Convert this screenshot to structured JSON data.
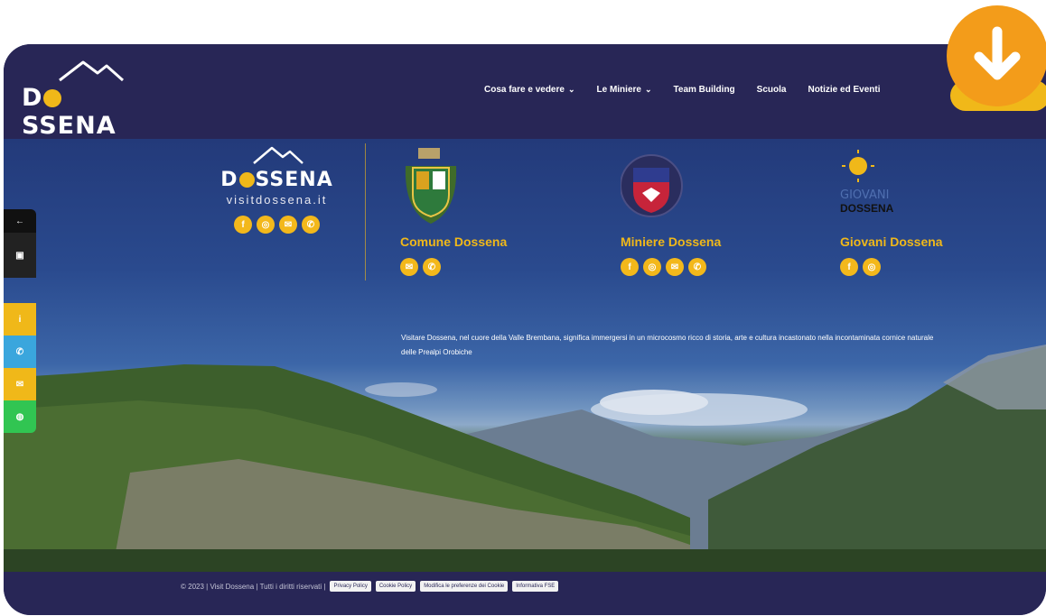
{
  "header": {
    "logo_text_pre": "D",
    "logo_text_post": "SSENA",
    "nav": [
      {
        "label": "Cosa fare e vedere",
        "has_dropdown": true
      },
      {
        "label": "Le Miniere",
        "has_dropdown": true
      },
      {
        "label": "Team Building",
        "has_dropdown": false
      },
      {
        "label": "Scuola",
        "has_dropdown": false
      },
      {
        "label": "Notizie ed Eventi",
        "has_dropdown": false
      }
    ],
    "dropdown_icon": "chevron-down-icon"
  },
  "brand": {
    "name_pre": "D",
    "name_post": "SSENA",
    "site": "visitdossena.it",
    "socials": [
      "facebook-icon",
      "instagram-icon",
      "mail-icon",
      "phone-icon"
    ]
  },
  "orgs": [
    {
      "title": "Comune Dossena",
      "socials": [
        "mail-icon",
        "phone-icon"
      ]
    },
    {
      "title": "Miniere Dossena",
      "socials": [
        "facebook-icon",
        "instagram-icon",
        "mail-icon",
        "phone-icon"
      ]
    },
    {
      "title": "Giovani Dossena",
      "logo_top": "GIOVANI",
      "logo_bottom": "DOSSENA",
      "socials": [
        "facebook-icon",
        "instagram-icon"
      ]
    }
  ],
  "description": "Visitare Dossena, nel cuore della Valle Brembana, significa immergersi in un microcosmo ricco di storia, arte e cultura incastonato nella incontaminata cornice naturale delle Prealpi Orobiche",
  "footer": {
    "copyright": "© 2023 | Visit Dossena | Tutti i diritti riservati |",
    "links": [
      "Privacy Policy",
      "Cookie Policy",
      "Modifica le preferenze dei Cookie",
      "Informativa FSE"
    ]
  },
  "colors": {
    "navy": "#282656",
    "gold": "#f0b819",
    "orange": "#f39c1a"
  }
}
